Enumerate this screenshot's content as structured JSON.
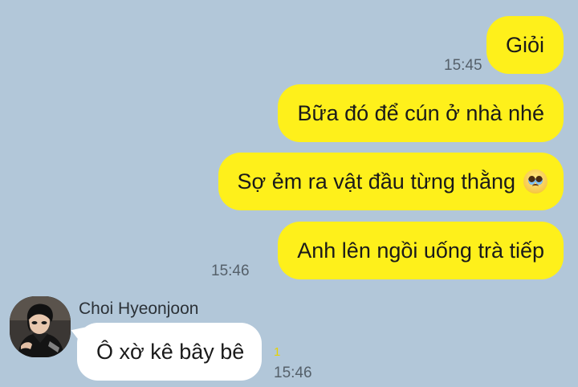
{
  "outgoing_messages": [
    {
      "text": "Giỏi",
      "time": "15:45"
    },
    {
      "text": "Bữa đó để cún ở nhà nhé"
    },
    {
      "text": "Sợ ẻm ra vật đầu từng thằng",
      "emoji": "pleading-face-icon"
    },
    {
      "text": "Anh lên ngồi uống trà tiếp",
      "time": "15:46"
    }
  ],
  "incoming": {
    "sender": "Choi Hyeonjoon",
    "text": "Ô xờ kê bây bê",
    "unread_count": "1",
    "time": "15:46"
  },
  "colors": {
    "background": "#b2c7d9",
    "outgoing_bubble": "#fef01b",
    "incoming_bubble": "#ffffff"
  }
}
